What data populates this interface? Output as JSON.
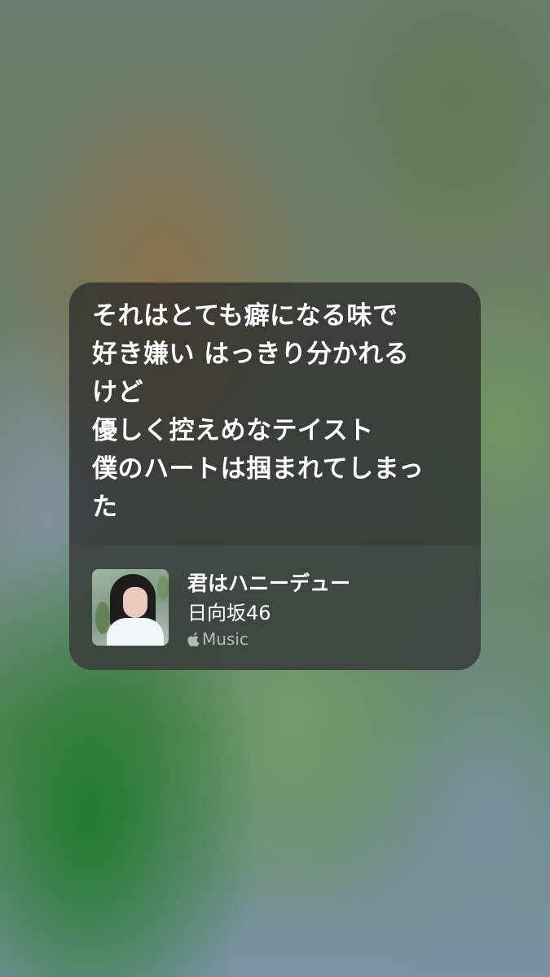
{
  "lyrics": {
    "lines": [
      "それはとても癖になる味で",
      "好き嫌い はっきり分かれる",
      "けど",
      "優しく控えめなテイスト",
      "僕のハートは掴まれてしまっ",
      "た"
    ]
  },
  "now_playing": {
    "title": "君はハニーデュー",
    "artist": "日向坂46",
    "service": "Music",
    "service_icon": "apple-icon",
    "artwork": "album-artwork"
  },
  "colors": {
    "card_background": "#2d2d2d",
    "text_primary": "#ffffff",
    "text_secondary": "#a0a4a2"
  }
}
